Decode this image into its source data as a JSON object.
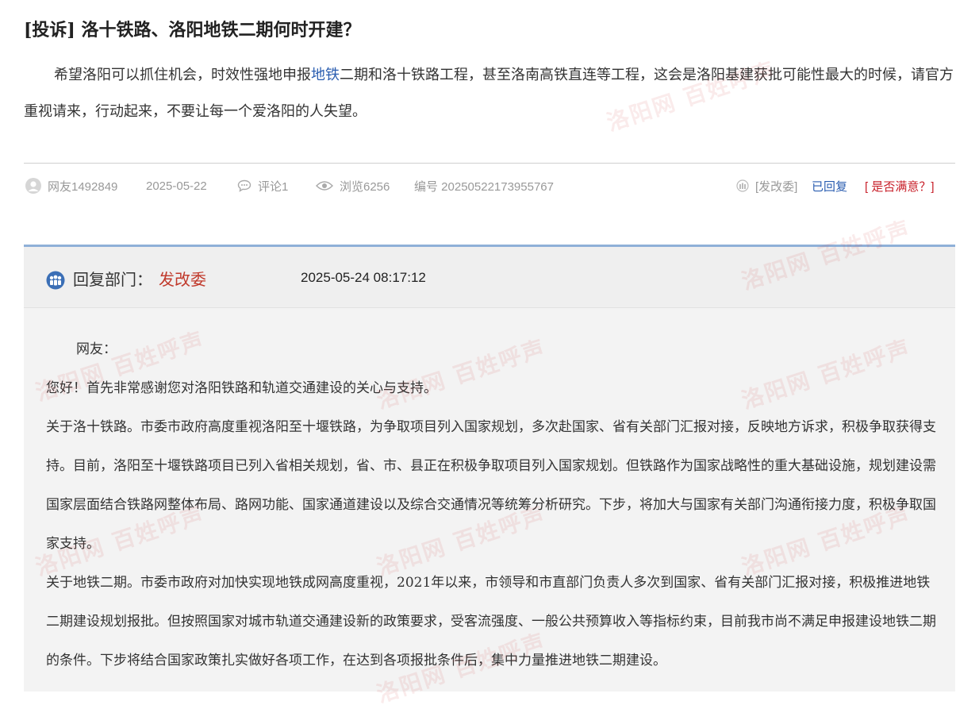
{
  "post": {
    "tag": "[投诉]",
    "title": "洛十铁路、洛阳地铁二期何时开建？",
    "body_before": "希望洛阳可以抓住机会，时效性强地申报",
    "body_link": "地铁",
    "body_after": "二期和洛十铁路工程，甚至洛南高铁直连等工程，这会是洛阳基建获批可能性最大的时候，请官方重视请来，行动起来，不要让每一个爱洛阳的人失望。"
  },
  "meta": {
    "user": "网友1492849",
    "date": "2025-05-22",
    "comments": "评论1",
    "views": "浏览6256",
    "number": "编号 20250522173955767",
    "department": "[发改委]",
    "status": "已回复",
    "satisfaction": "[ 是否满意？]"
  },
  "reply": {
    "label": "回复部门：",
    "department": "发改委",
    "time": "2025-05-24 08:17:12",
    "greeting": "网友：",
    "paragraphs": [
      "您好！首先非常感谢您对洛阳铁路和轨道交通建设的关心与支持。",
      "关于洛十铁路。市委市政府高度重视洛阳至十堰铁路，为争取项目列入国家规划，多次赴国家、省有关部门汇报对接，反映地方诉求，积极争取获得支持。目前，洛阳至十堰铁路项目已列入省相关规划，省、市、县正在积极争取项目列入国家规划。但铁路作为国家战略性的重大基础设施，规划建设需国家层面结合铁路网整体布局、路网功能、国家通道建设以及综合交通情况等统筹分析研究。下步，将加大与国家有关部门沟通衔接力度，积极争取国家支持。",
      "关于地铁二期。市委市政府对加快实现地铁成网高度重视，2021年以来，市领导和市直部门负责人多次到国家、省有关部门汇报对接，积极推进地铁二期建设规划报批。但按照国家对城市轨道交通建设新的政策要求，受客流强度、一般公共预算收入等指标约束，目前我市尚不满足申报建设地铁二期的条件。下步将结合国家政策扎实做好各项工作，在达到各项报批条件后，集中力量推进地铁二期建设。"
    ]
  },
  "watermark_text": "洛阳网 百姓呼声",
  "colors": {
    "link": "#2a5db0",
    "alert": "#c8202a",
    "reply_dept": "#c0392b",
    "reply_border": "#8fb0d8"
  }
}
